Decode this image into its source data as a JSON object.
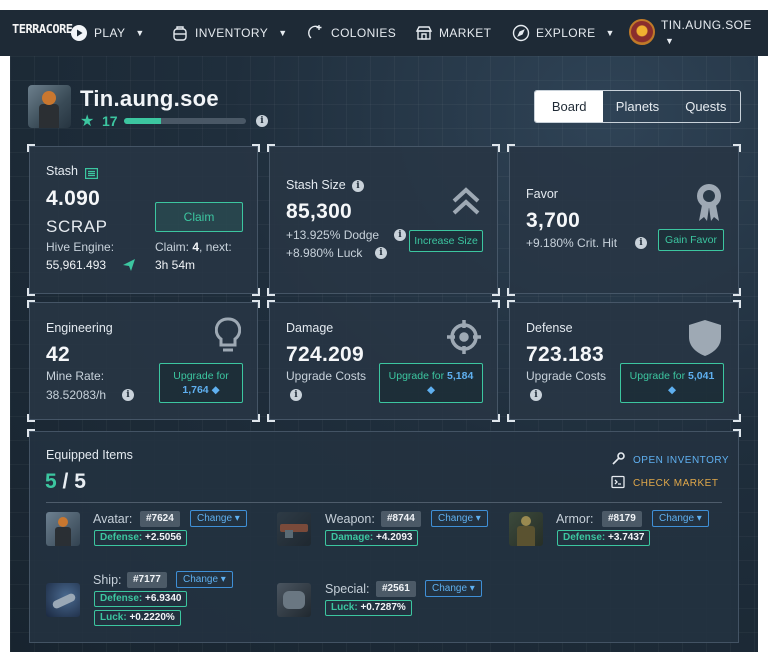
{
  "nav": {
    "logo": "TERRACORE",
    "items": [
      {
        "label": "PLAY",
        "icon": "play-icon",
        "caret": true
      },
      {
        "label": "INVENTORY",
        "icon": "backpack-icon",
        "caret": true
      },
      {
        "label": "COLONIES",
        "icon": "planet-icon",
        "caret": false
      },
      {
        "label": "MARKET",
        "icon": "store-icon",
        "caret": false
      },
      {
        "label": "EXPLORE",
        "icon": "compass-icon",
        "caret": true
      }
    ],
    "username": "TIN.AUNG.SOE"
  },
  "profile": {
    "name": "Tin.aung.soe",
    "level": "17",
    "xp_progress": 0.3
  },
  "tabs": [
    "Board",
    "Planets",
    "Quests"
  ],
  "active_tab": "Board",
  "stash": {
    "label": "Stash",
    "value": "4.090",
    "unit": "SCRAP",
    "claim_button": "Claim",
    "hive_label": "Hive Engine:",
    "hive_value": "55,961.493",
    "claim_text": "Claim: 4, next:",
    "claim_next": "3h 54m"
  },
  "stash_size": {
    "label": "Stash Size",
    "value": "85,300",
    "dodge": "+13.925% Dodge",
    "luck": "+8.980% Luck",
    "button": "Increase Size"
  },
  "favor": {
    "label": "Favor",
    "value": "3,700",
    "crit": "+9.180% Crit. Hit",
    "button": "Gain Favor"
  },
  "engineering": {
    "label": "Engineering",
    "value": "42",
    "mine_label": "Mine Rate:",
    "mine_value": "38.52083/h",
    "upgrade_label": "Upgrade for",
    "upgrade_cost": "1,764"
  },
  "damage": {
    "label": "Damage",
    "value": "724.209",
    "upgrade_costs_label": "Upgrade Costs",
    "upgrade_label": "Upgrade for",
    "upgrade_cost": "5,184"
  },
  "defense": {
    "label": "Defense",
    "value": "723.183",
    "upgrade_costs_label": "Upgrade Costs",
    "upgrade_label": "Upgrade for",
    "upgrade_cost": "5,041"
  },
  "equipped": {
    "title": "Equipped Items",
    "count": "5",
    "slash": "/",
    "total": "5",
    "open_inventory": "OPEN INVENTORY",
    "check_market": "CHECK MARKET",
    "change_label": "Change",
    "items": [
      {
        "slot": "Avatar:",
        "id": "#7624",
        "stats": [
          {
            "k": "Defense:",
            "v": "+2.5056"
          }
        ]
      },
      {
        "slot": "Weapon:",
        "id": "#8744",
        "stats": [
          {
            "k": "Damage:",
            "v": "+4.2093"
          }
        ]
      },
      {
        "slot": "Armor:",
        "id": "#8179",
        "stats": [
          {
            "k": "Defense:",
            "v": "+3.7437"
          }
        ]
      },
      {
        "slot": "Ship:",
        "id": "#7177",
        "stats": [
          {
            "k": "Defense:",
            "v": "+6.9340"
          },
          {
            "k": "Luck:",
            "v": "+0.2220%"
          }
        ]
      },
      {
        "slot": "Special:",
        "id": "#2561",
        "stats": [
          {
            "k": "Luck:",
            "v": "+0.7287%"
          }
        ]
      }
    ]
  },
  "colors": {
    "accent": "#3cc6a0",
    "link_blue": "#5fb0f0",
    "market_orange": "#e0a84a",
    "nav_bg": "#1e2a36"
  }
}
